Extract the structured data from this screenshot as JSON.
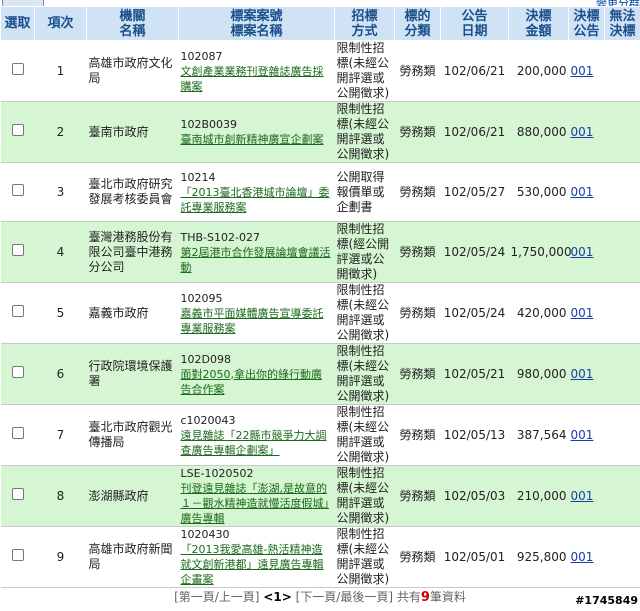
{
  "topbar": {
    "button_label": "",
    "link_label": "變更分群"
  },
  "headers": {
    "select": "選取",
    "seq": "項次",
    "agency": "機關\n名稱",
    "case": "標案案號\n標案名稱",
    "method": "招標\n方式",
    "category": "標的\n分類",
    "date": "公告\n日期",
    "amount": "決標\n金額",
    "award": "決標\n公告",
    "fail": "無法\n決標"
  },
  "rows": [
    {
      "seq": "1",
      "agency": "高雄市政府文化局",
      "code": "102087",
      "title": "文創產業業務刊登雜誌廣告採購案",
      "method": "限制性招標(未經公開評選或公開徵求)",
      "category": "勞務類",
      "date": "102/06/21",
      "amount": "200,000",
      "award": "001"
    },
    {
      "seq": "2",
      "agency": "臺南市政府",
      "code": "102B0039",
      "title": "臺南城市創新精神廣宣企劃案",
      "method": "限制性招標(未經公開評選或公開徵求)",
      "category": "勞務類",
      "date": "102/06/21",
      "amount": "880,000",
      "award": "001"
    },
    {
      "seq": "3",
      "agency": "臺北市政府研究發展考核委員會",
      "code": "10214",
      "title": "「2013臺北香港城市論壇」委託專業服務案",
      "method": "公開取得報價單或企劃書",
      "category": "勞務類",
      "date": "102/05/27",
      "amount": "530,000",
      "award": "001"
    },
    {
      "seq": "4",
      "agency": "臺灣港務股份有限公司臺中港務分公司",
      "code": "THB-S102-027",
      "title": "第2屆港市合作發展論壇會議活動",
      "method": "限制性招標(經公開評選或公開徵求)",
      "category": "勞務類",
      "date": "102/05/24",
      "amount": "1,750,000",
      "award": "001"
    },
    {
      "seq": "5",
      "agency": "嘉義市政府",
      "code": "102095",
      "title": "嘉義市平面媒體廣告宣導委託專業服務案",
      "method": "限制性招標(未經公開評選或公開徵求)",
      "category": "勞務類",
      "date": "102/05/24",
      "amount": "420,000",
      "award": "001"
    },
    {
      "seq": "6",
      "agency": "行政院環境保護署",
      "code": "102D098",
      "title": "面對2050,拿出你的綠行動廣告合作案",
      "method": "限制性招標(未經公開評選或公開徵求)",
      "category": "勞務類",
      "date": "102/05/21",
      "amount": "980,000",
      "award": "001"
    },
    {
      "seq": "7",
      "agency": "臺北市政府觀光傳播局",
      "code": "c1020043",
      "title": "遠見雜誌「22縣市競爭力大調查廣告專輯企劃案」",
      "method": "限制性招標(未經公開評選或公開徵求)",
      "category": "勞務類",
      "date": "102/05/13",
      "amount": "387,564",
      "award": "001"
    },
    {
      "seq": "8",
      "agency": "澎湖縣政府",
      "code": "LSE-1020502",
      "title": "刊登遠見雜誌「澎湖,是故意的１－觀水精神造就慢活度假城」廣告專輯",
      "method": "限制性招標(未經公開評選或公開徵求)",
      "category": "勞務類",
      "date": "102/05/03",
      "amount": "210,000",
      "award": "001"
    },
    {
      "seq": "9",
      "agency": "高雄市政府新聞局",
      "code": "1020430",
      "title": "「2013我愛高雄-熱活精神造就文創新港都」遠見廣告專輯企畫案",
      "method": "限制性招標(未經公開評選或公開徵求)",
      "category": "勞務類",
      "date": "102/05/01",
      "amount": "925,800",
      "award": "001"
    }
  ],
  "pager": {
    "first_prev": "[第一頁/上一頁]",
    "page": "<1>",
    "next_last": "[下一頁/最後一頁]",
    "total_prefix": "共有",
    "total_count": "9",
    "total_suffix": "筆資料"
  },
  "watermark": "#1745849"
}
